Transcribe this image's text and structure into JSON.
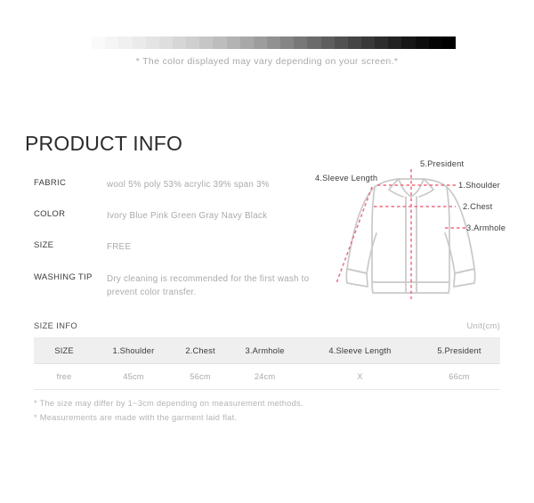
{
  "swatch_bar": {
    "name": "grayscale-gradient-bar",
    "colors": [
      "#ffffff",
      "#fafafa",
      "#f5f5f5",
      "#f0f0f0",
      "#eaeaea",
      "#e4e4e4",
      "#dedede",
      "#d6d6d6",
      "#cfcfcf",
      "#c6c6c6",
      "#bdbdbd",
      "#b3b3b3",
      "#a8a8a8",
      "#9d9d9d",
      "#919191",
      "#858585",
      "#787878",
      "#6b6b6b",
      "#5e5e5e",
      "#515151",
      "#454545",
      "#393939",
      "#2d2d2d",
      "#222222",
      "#171717",
      "#0d0d0d",
      "#050505",
      "#000000"
    ]
  },
  "screen_note": "* The color displayed may vary depending on your screen.*",
  "product_info": {
    "title": "PRODUCT INFO",
    "rows": [
      {
        "label": "FABRIC",
        "value": "wool 5% poly 53% acrylic 39% span 3%"
      },
      {
        "label": "COLOR",
        "value": "Ivory Blue Pink Green Gray Navy Black"
      },
      {
        "label": "SIZE",
        "value": "FREE"
      },
      {
        "label": "WASHING TIP",
        "value": "Dry cleaning is recommended for the first wash to prevent color transfer."
      }
    ]
  },
  "diagram": {
    "name": "garment-measurement-diagram",
    "outline_color": "#c9c9c9",
    "measure_line_color": "#f26a7e",
    "labels": {
      "sleeve_length": "4.Sleeve Length",
      "president": "5.President",
      "shoulder": "1.Shoulder",
      "chest": "2.Chest",
      "armhole": "3.Armhole"
    }
  },
  "size_info": {
    "heading": "SIZE INFO",
    "unit": "Unit(cm)",
    "columns": [
      "SIZE",
      "1.Shoulder",
      "2.Chest",
      "3.Armhole",
      "4.Sleeve Length",
      "5.President"
    ],
    "rows": [
      [
        "free",
        "45cm",
        "56cm",
        "24cm",
        "X",
        "66cm"
      ]
    ],
    "notes": [
      "* The size may differ by 1~3cm depending on measurement methods.",
      "* Measurements are made with the garment laid flat."
    ]
  }
}
